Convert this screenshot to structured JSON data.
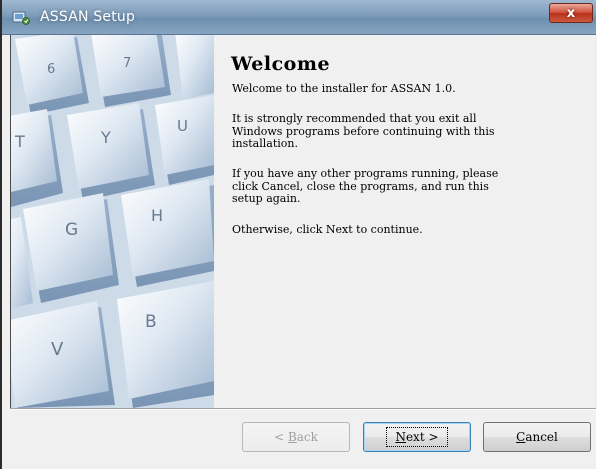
{
  "window": {
    "title": "ASSAN Setup",
    "close_label": "x"
  },
  "page": {
    "heading": "Welcome",
    "paragraphs": [
      "Welcome to the installer for ASSAN 1.0.",
      "It is strongly recommended that you exit all\nWindows programs before continuing with this\ninstallation.",
      "If you have any other programs running, please\nclick Cancel, close the programs, and run this\nsetup again.",
      "Otherwise, click Next to continue."
    ]
  },
  "keyboard": {
    "keys": [
      "6",
      "7",
      "T",
      "Y",
      "U",
      "G",
      "H",
      "V",
      "B"
    ]
  },
  "buttons": {
    "back": {
      "mnemonic": "B",
      "rest": "ack",
      "arrow": "<",
      "enabled": false
    },
    "next": {
      "mnemonic": "N",
      "rest": "ext",
      "arrow": ">",
      "focused": true
    },
    "cancel": {
      "mnemonic": "C",
      "rest": "ancel"
    }
  },
  "colors": {
    "title_bar": "#7e9dbb",
    "close_button": "#c8432b",
    "key_blue": "#aec4dc",
    "dialog_bg": "#f0f0f0"
  }
}
